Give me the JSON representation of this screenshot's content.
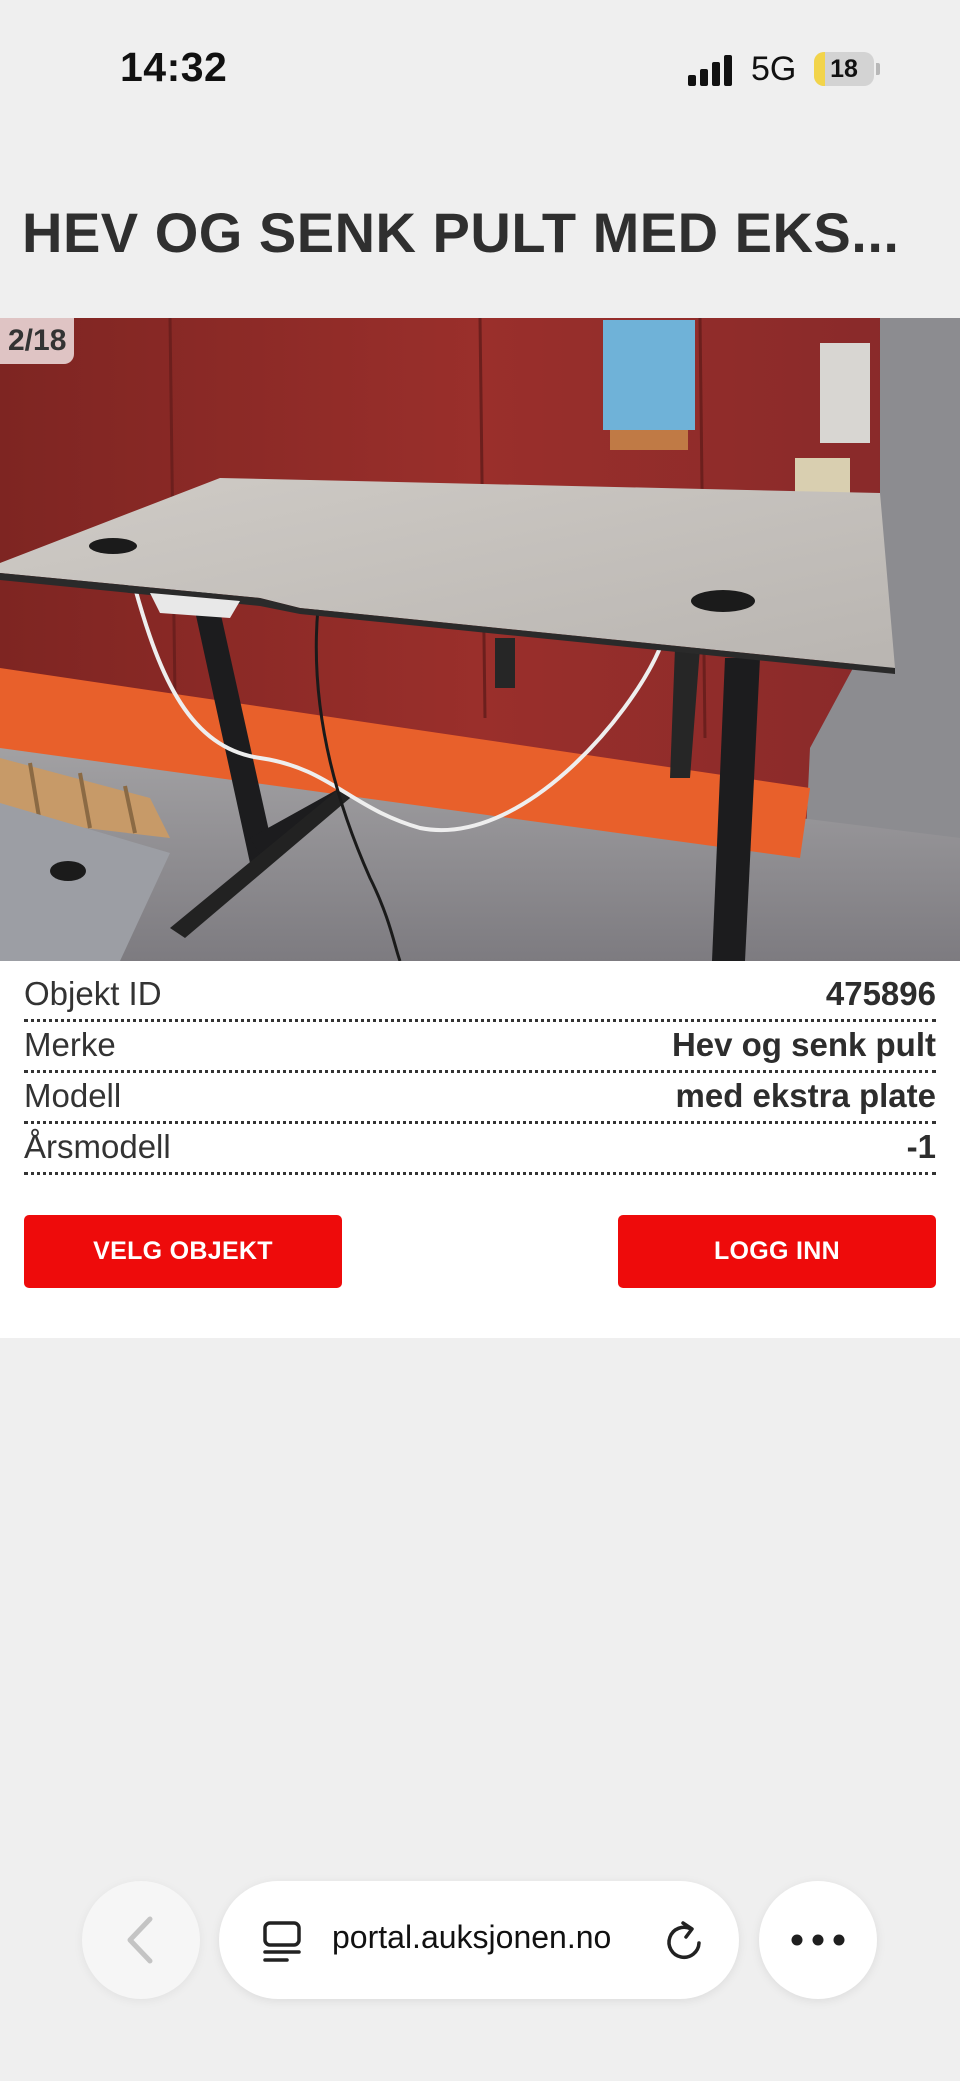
{
  "status_bar": {
    "time": "14:32",
    "network": "5G",
    "battery": "18",
    "battery_level": 0.18
  },
  "page": {
    "title": "HEV OG SENK PULT MED EKS..."
  },
  "gallery": {
    "counter": "2/18"
  },
  "specs": [
    {
      "label": "Objekt ID",
      "value": "475896"
    },
    {
      "label": "Merke",
      "value": "Hev og senk pult"
    },
    {
      "label": "Modell",
      "value": "med ekstra plate"
    },
    {
      "label": "Årsmodell",
      "value": "-1"
    }
  ],
  "buttons": {
    "select": "VELG OBJEKT",
    "login": "LOGG INN"
  },
  "browser": {
    "url": "portal.auksjonen.no"
  },
  "colors": {
    "accent": "#ee0b0b",
    "background": "#efefef"
  },
  "icons": [
    "signal-icon",
    "battery-icon",
    "back-chevron-icon",
    "tabs-icon",
    "reload-icon",
    "more-icon"
  ]
}
